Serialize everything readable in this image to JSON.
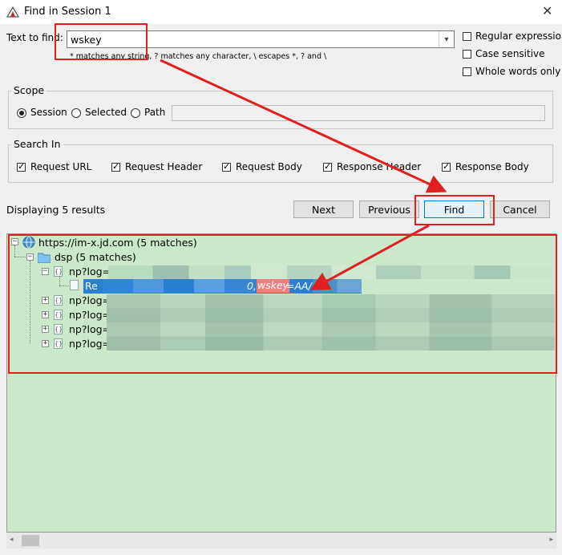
{
  "window": {
    "title": "Find in Session 1",
    "close_glyph": "✕"
  },
  "find": {
    "label": "Text to find:",
    "value": "wskey",
    "hint": "* matches any string, ? matches any character, \\ escapes *, ? and \\"
  },
  "options": [
    {
      "label": "Regular expression",
      "checked": false
    },
    {
      "label": "Case sensitive",
      "checked": false
    },
    {
      "label": "Whole words only",
      "checked": false
    }
  ],
  "scope": {
    "title": "Scope",
    "options": [
      {
        "label": "Session",
        "selected": true
      },
      {
        "label": "Selected",
        "selected": false
      },
      {
        "label": "Path",
        "selected": false
      }
    ]
  },
  "search_in": {
    "title": "Search In",
    "options": [
      {
        "label": "Request URL",
        "checked": true
      },
      {
        "label": "Request Header",
        "checked": true
      },
      {
        "label": "Request Body",
        "checked": true
      },
      {
        "label": "Response Header",
        "checked": true
      },
      {
        "label": "Response Body",
        "checked": true
      }
    ]
  },
  "status": "Displaying 5 results",
  "buttons": {
    "next": "Next",
    "previous": "Previous",
    "find": "Find",
    "cancel": "Cancel"
  },
  "tree": {
    "host": "https://im-x.jd.com (5 matches)",
    "folder": "dsp (5 matches)",
    "request_prefix": "np?log=",
    "child_prefix": "Re",
    "match_text": "wskey",
    "match_suffix": "=AA/",
    "match_lead": "0,"
  },
  "colors": {
    "results_bg": "#cbe8cb",
    "annotation": "#e02020",
    "selection": "#2a7fd0",
    "match_highlight": "#f08080"
  }
}
